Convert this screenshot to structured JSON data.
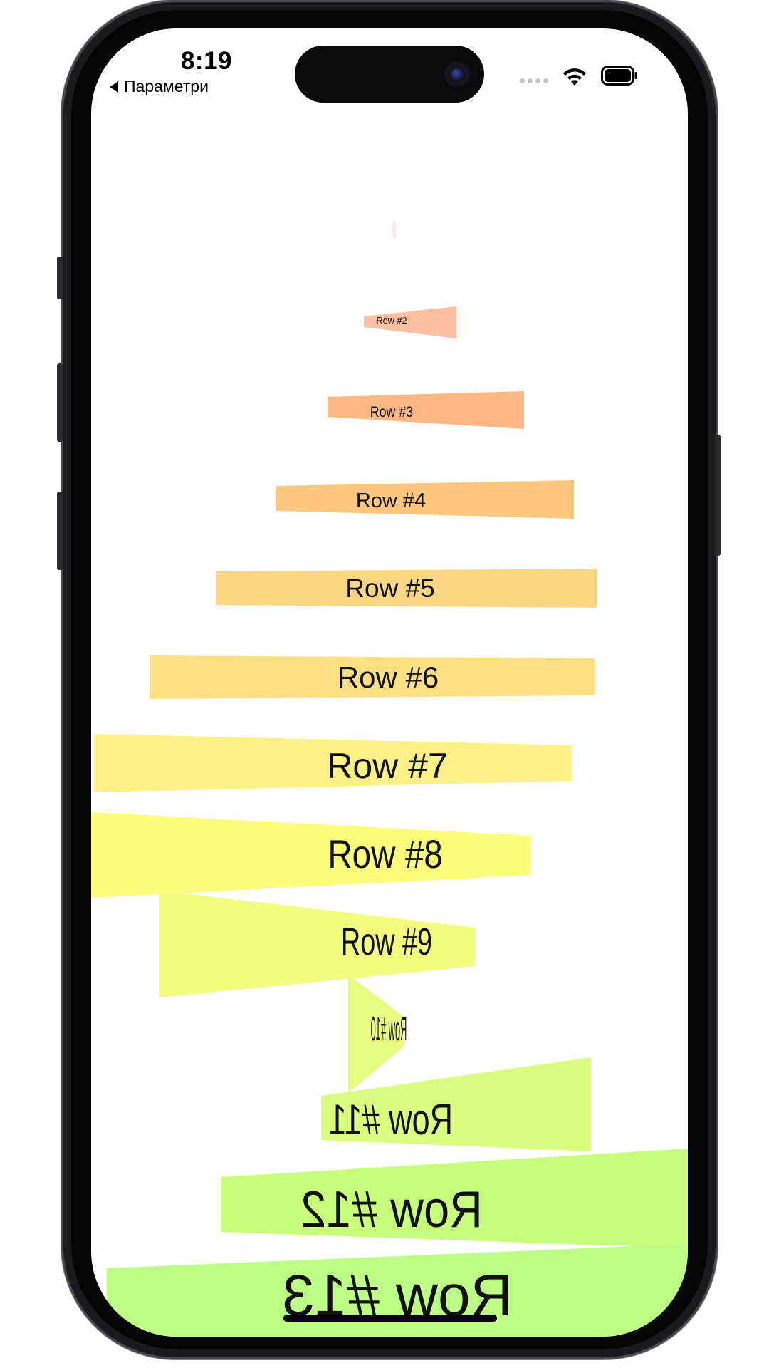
{
  "status_bar": {
    "time": "8:19",
    "back_label": "Параметри"
  },
  "rows": [
    {
      "label": "Row #2",
      "color": "#fbbfa2"
    },
    {
      "label": "Row #3",
      "color": "#fdb785"
    },
    {
      "label": "Row #4",
      "color": "#fdc77f"
    },
    {
      "label": "Row #5",
      "color": "#fdd683"
    },
    {
      "label": "Row #6",
      "color": "#fde081"
    },
    {
      "label": "Row #7",
      "color": "#fdf084"
    },
    {
      "label": "Row #8",
      "color": "#fdfd7c"
    },
    {
      "label": "Row #9",
      "color": "#f2fd80"
    },
    {
      "label": "Row #10",
      "color": "#e7fd80"
    },
    {
      "label": "Row #11",
      "color": "#d8fd7f"
    },
    {
      "label": "Row #12",
      "color": "#c8fd7c"
    },
    {
      "label": "Row #13",
      "color": "#befd85"
    }
  ]
}
